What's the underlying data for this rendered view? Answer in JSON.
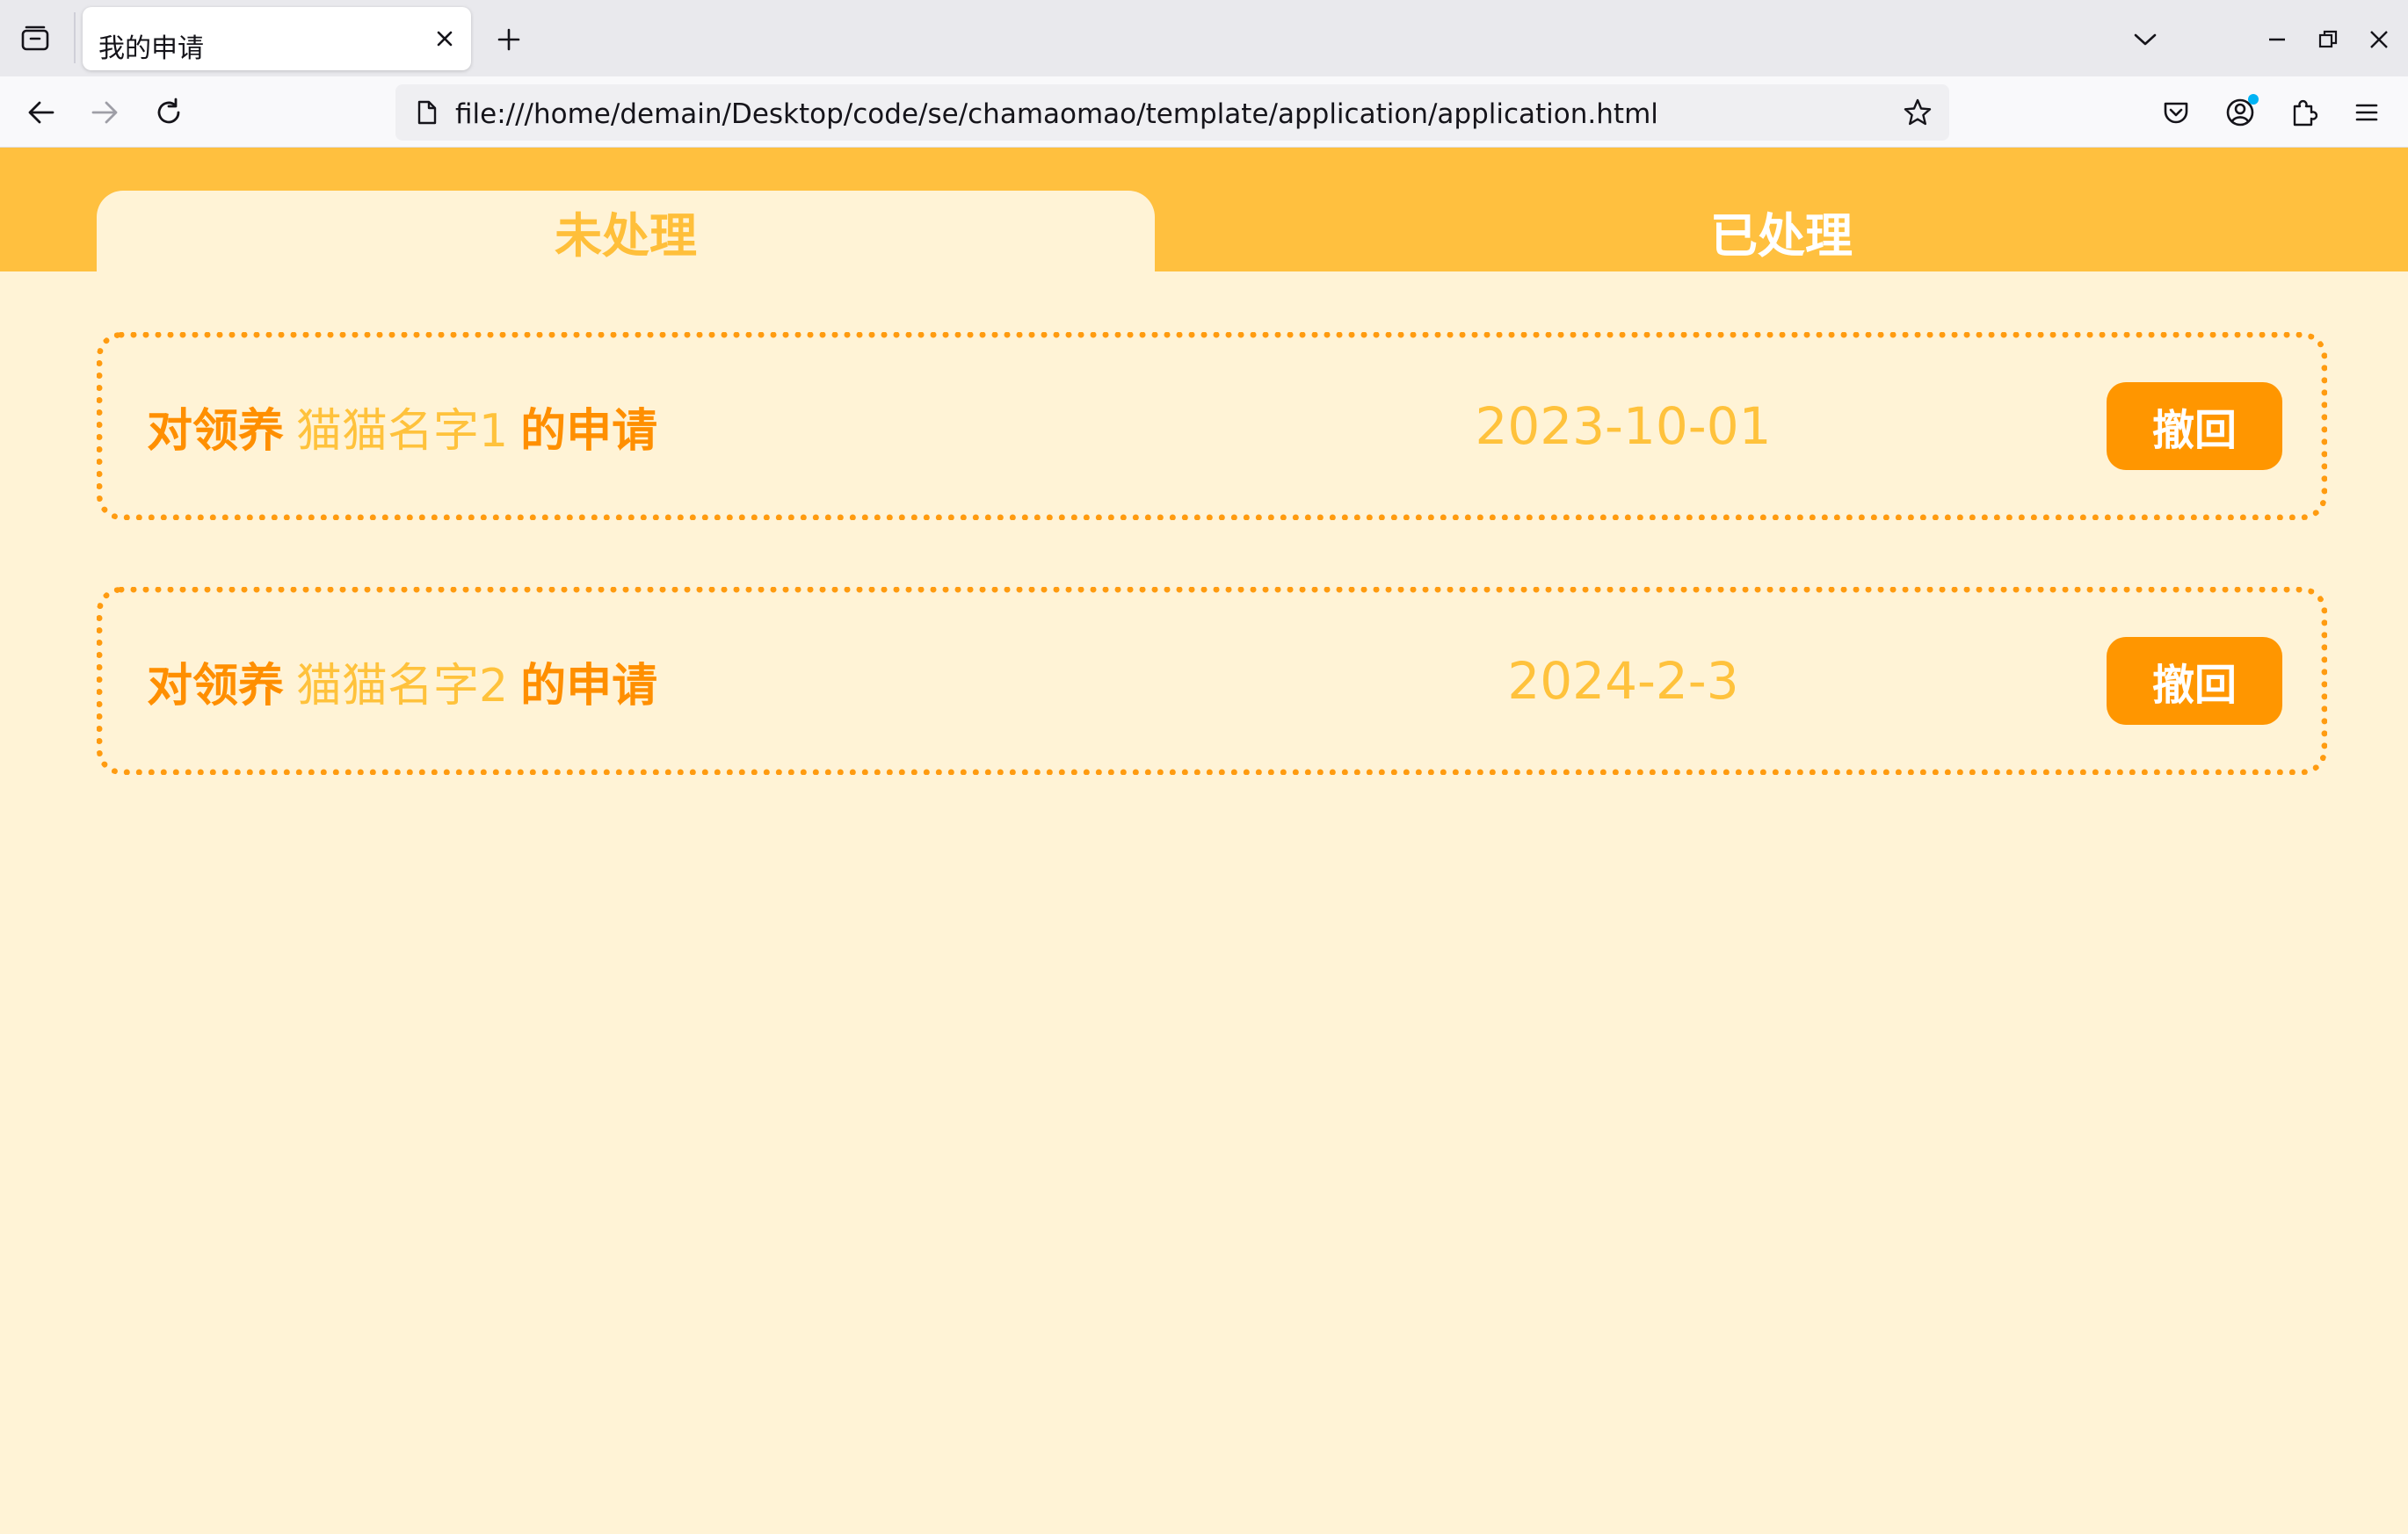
{
  "browser": {
    "tab_title": "我的申请",
    "url": "file:///home/demain/Desktop/code/se/chamaomao/template/application/application.html",
    "icons": {
      "tab_overview": "tab-overview-icon",
      "close_tab": "close-icon",
      "new_tab": "plus-icon",
      "list_tabs": "chevron-down-icon",
      "minimize": "minimize-icon",
      "restore": "restore-icon",
      "close_window": "close-icon",
      "back": "arrow-left-icon",
      "forward": "arrow-right-icon",
      "reload": "reload-icon",
      "page": "page-icon",
      "bookmark": "star-icon",
      "pocket": "pocket-icon",
      "account": "account-icon",
      "extensions": "puzzle-icon",
      "menu": "hamburger-icon"
    }
  },
  "page": {
    "colors": {
      "background": "#fff3d6",
      "header": "#ffc03f",
      "accent": "#ff9600",
      "light_accent": "#ffc23c"
    },
    "tabs": [
      {
        "label": "未处理",
        "active": true
      },
      {
        "label": "已处理",
        "active": false
      }
    ],
    "applications": [
      {
        "prefix": "对领养",
        "cat_name": "猫猫名字1",
        "suffix": "的申请",
        "date": "2023-10-01",
        "action": "撤回"
      },
      {
        "prefix": "对领养",
        "cat_name": "猫猫名字2",
        "suffix": "的申请",
        "date": "2024-2-3",
        "action": "撤回"
      }
    ]
  }
}
